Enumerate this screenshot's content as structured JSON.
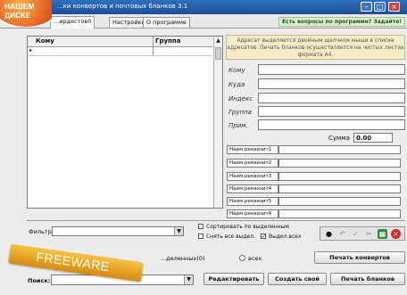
{
  "window": {
    "title": "...ки конвертов и почтовых бланков 3.1"
  },
  "tabs": [
    {
      "label": "...ирдестов0"
    },
    {
      "label": "Настройки"
    },
    {
      "label": "О программе"
    }
  ],
  "help_link": "Есть вопросы по программе? Задайте!",
  "grid": {
    "columns": [
      "Кому",
      "Группа"
    ],
    "row_marker": "▸"
  },
  "info_text": "Адресат выделяется двойным щелчком мыши в списке адресатов. Печать бланков осуществляется на чистых листах формата А4.",
  "form": {
    "fields": [
      {
        "label": "Кому"
      },
      {
        "label": "Куда"
      },
      {
        "label": "Индекс"
      },
      {
        "label": "Группа"
      },
      {
        "label": "Прим."
      }
    ],
    "sum_label": "Сумма",
    "sum_value": "0.00"
  },
  "sender_labels": [
    "Наим.реквизит1",
    "Наим.реквизит2",
    "Наим.реквизит3",
    "Наим.реквизит4",
    "Наим.реквизит5",
    "Наим.реквизит6"
  ],
  "filter": {
    "label": "Фильтр"
  },
  "checkboxes": [
    {
      "label": "Сортировать по выделенным",
      "checked": false
    },
    {
      "label": "Снять все выдел.",
      "checked": false
    },
    {
      "label": "Выдел.всех",
      "checked": true
    }
  ],
  "toolbar_icons": [
    "record-icon",
    "back-icon",
    "check-icon",
    "cut-icon",
    "excel-icon",
    "delete-icon"
  ],
  "print_options": {
    "selected_label": "...деленных(0)",
    "all_label": "всех"
  },
  "buttons": {
    "print_envelopes": "Печать конвертов",
    "edit": "Редактировать",
    "create_new": "Создать свой",
    "print_forms": "Печать бланков"
  },
  "search": {
    "label": "Поиск:"
  },
  "badges": {
    "top_line1": "НАШЕМ",
    "top_line2": "ДИСКЕ",
    "freeware": "FREEWARE"
  }
}
